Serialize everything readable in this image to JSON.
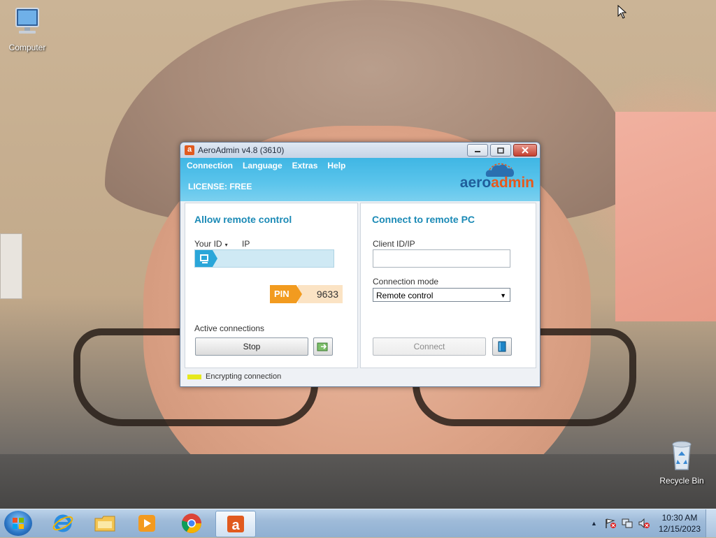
{
  "desktop": {
    "icons": [
      {
        "label": "Computer",
        "icon": "computer-icon"
      },
      {
        "label": "Recycle Bin",
        "icon": "recycle-bin-icon"
      }
    ]
  },
  "window": {
    "title": "AeroAdmin v4.8 (3610)",
    "menu": [
      "Connection",
      "Language",
      "Extras",
      "Help"
    ],
    "license": "LICENSE: FREE",
    "brand": {
      "part1": "aero",
      "part2": "admin"
    },
    "left_panel": {
      "title": "Allow remote control",
      "your_id_label": "Your ID",
      "ip_label": "IP",
      "your_id_value": "",
      "pin_label": "PIN",
      "pin_value": "9633",
      "active_connections_label": "Active connections",
      "stop_button": "Stop"
    },
    "right_panel": {
      "title": "Connect to remote PC",
      "client_id_label": "Client ID/IP",
      "client_id_value": "",
      "connection_mode_label": "Connection mode",
      "connection_mode_value": "Remote control",
      "connect_button": "Connect"
    },
    "status": {
      "text": "Encrypting connection",
      "color": "#e6e81e"
    }
  },
  "taskbar": {
    "pinned": [
      "internet-explorer-icon",
      "file-explorer-icon",
      "media-player-icon",
      "chrome-icon",
      "aeroadmin-icon"
    ],
    "clock": {
      "time": "10:30 AM",
      "date": "12/15/2023"
    }
  },
  "colors": {
    "accent": "#3fb6e4",
    "brand_blue": "#1f5e9b",
    "brand_orange": "#e7581c",
    "pin_orange": "#f29b1f"
  }
}
